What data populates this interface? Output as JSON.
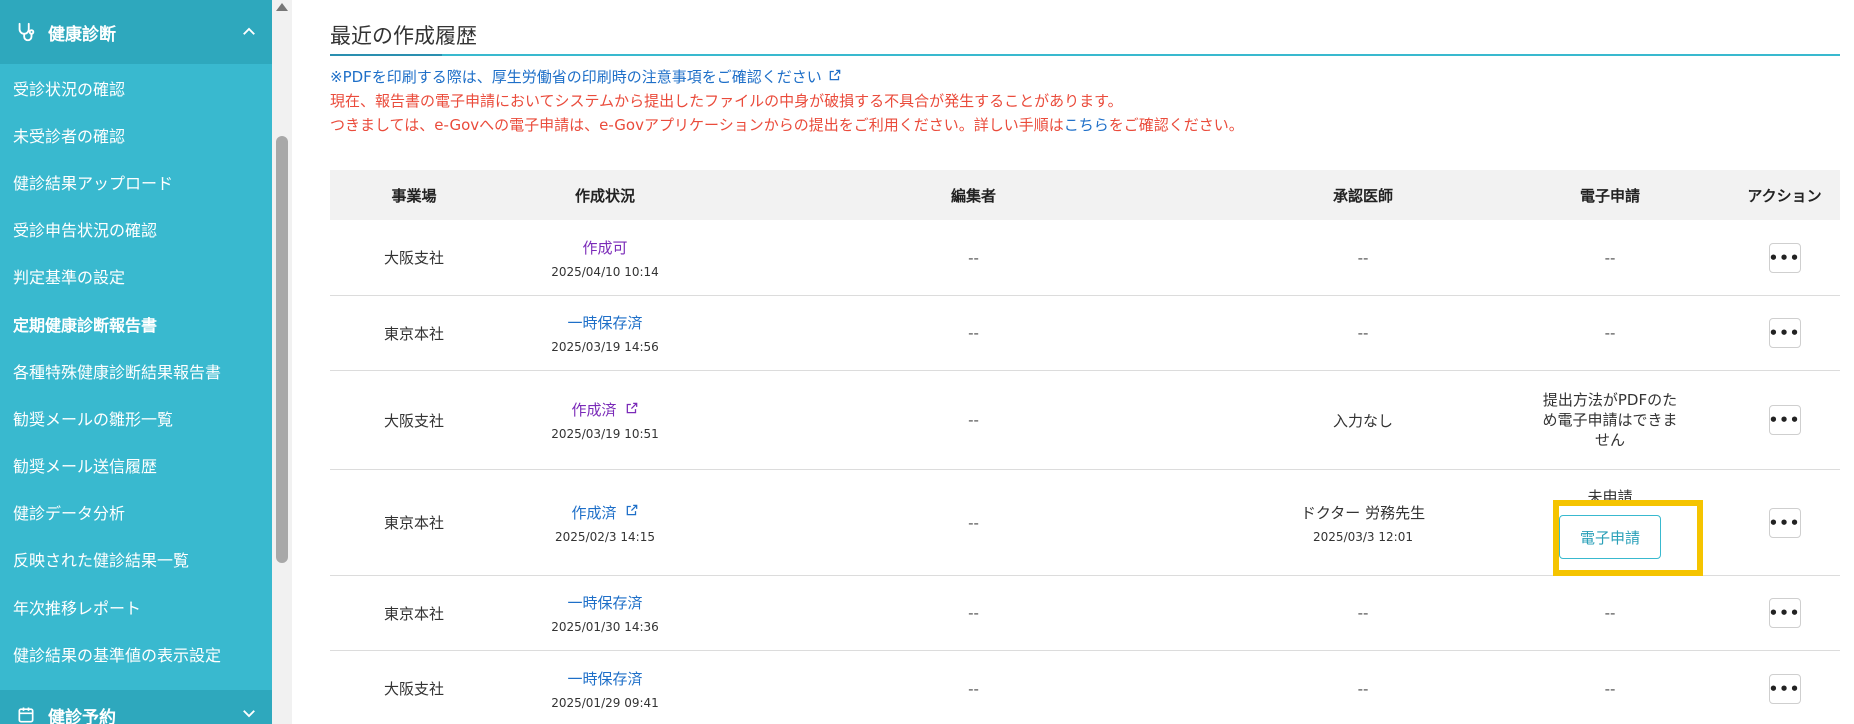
{
  "sidebar": {
    "section": "健康診断",
    "items": [
      {
        "label": "受診状況の確認"
      },
      {
        "label": "未受診者の確認"
      },
      {
        "label": "健診結果アップロード"
      },
      {
        "label": "受診申告状況の確認"
      },
      {
        "label": "判定基準の設定"
      },
      {
        "label": "定期健康診断報告書"
      },
      {
        "label": "各種特殊健康診断結果報告書"
      },
      {
        "label": "勧奨メールの雛形一覧"
      },
      {
        "label": "勧奨メール送信履歴"
      },
      {
        "label": "健診データ分析"
      },
      {
        "label": "反映された健診結果一覧"
      },
      {
        "label": "年次推移レポート"
      },
      {
        "label": "健診結果の基準値の表示設定"
      }
    ],
    "next_section": "健診予約"
  },
  "main": {
    "title": "最近の作成履歴",
    "notice_pdf": "※PDFを印刷する際は、厚生労働省の印刷時の注意事項をご確認ください",
    "notice_bug": "現在、報告書の電子申請においてシステムから提出したファイルの中身が破損する不具合が発生することがあります。",
    "notice_egov_pre": "つきましては、e-Govへの電子申請は、e-Govアプリケーションからの提出をご利用ください。詳しい手順は",
    "notice_egov_link": "こちら",
    "notice_egov_post": "をご確認ください。"
  },
  "table": {
    "headers": {
      "office": "事業場",
      "status": "作成状況",
      "editor": "編集者",
      "doctor": "承認医師",
      "esubmit": "電子申請",
      "action": "アクション"
    },
    "rows": [
      {
        "office": "大阪支社",
        "status": "作成可",
        "date": "2025/04/10 10:14",
        "editor": "--",
        "doctor": "--",
        "esubmit": "--",
        "action": "•••"
      },
      {
        "office": "東京本社",
        "status": "一時保存済",
        "date": "2025/03/19 14:56",
        "editor": "--",
        "doctor": "--",
        "esubmit": "--",
        "action": "•••"
      },
      {
        "office": "大阪支社",
        "status": "作成済",
        "date": "2025/03/19 10:51",
        "editor": "--",
        "doctor": "入力なし",
        "esubmit": "提出方法がPDFのため電子申請はできません",
        "action": "•••"
      },
      {
        "office": "東京本社",
        "status": "作成済",
        "date": "2025/02/3 14:15",
        "editor": "--",
        "doctor": "ドクター 労務先生",
        "doctor_date": "2025/03/3 12:01",
        "esubmit": "未申請",
        "esubmit_button": "電子申請",
        "action": "•••"
      },
      {
        "office": "東京本社",
        "status": "一時保存済",
        "date": "2025/01/30 14:36",
        "editor": "--",
        "doctor": "--",
        "esubmit": "--",
        "action": "•••"
      },
      {
        "office": "大阪支社",
        "status": "一時保存済",
        "date": "2025/01/29 09:41",
        "editor": "--",
        "doctor": "--",
        "esubmit": "--",
        "action": "•••"
      }
    ]
  },
  "colors": {
    "sidebar": "#39b9cf",
    "sidebar_header": "#2ea8bd",
    "link_blue": "#1e6fc8",
    "warning_red": "#ea4b3b",
    "status_purple": "#7a2ab8",
    "highlight": "#f5c400"
  }
}
